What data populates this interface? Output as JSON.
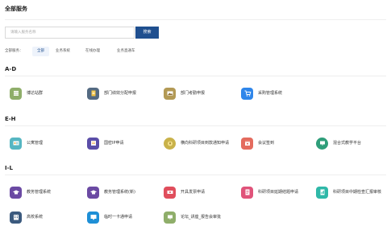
{
  "page": {
    "title": "全部服务"
  },
  "search": {
    "placeholder": "请输入服务名称",
    "button": "搜索"
  },
  "filter": {
    "label": "全部服务：",
    "chips": [
      "全部",
      "业务系统",
      "在线办理",
      "业务直通车"
    ]
  },
  "sections": [
    {
      "heading": "A-D",
      "items": [
        {
          "label": "博达站群",
          "icon": "database-icon",
          "color": "#8fae6a"
        },
        {
          "label": "部门绩效分配申报",
          "icon": "clipboard-icon",
          "color": "#546a82"
        },
        {
          "label": "部门考勤申报",
          "icon": "photo-icon",
          "color": "#b39a55"
        },
        {
          "label": "采购管理系统",
          "icon": "cart-icon",
          "color": "#2f86ea"
        }
      ]
    },
    {
      "heading": "E-H",
      "items": [
        {
          "label": "公寓管理",
          "icon": "id-card-icon",
          "color": "#56b6c2"
        },
        {
          "label": "国密IP申请",
          "icon": "document-icon",
          "color": "#5b4ea8"
        },
        {
          "label": "横向科研项目到款通知申请",
          "icon": "money-bag-icon",
          "color": "#c9b24a"
        },
        {
          "label": "会议签到",
          "icon": "calendar-icon",
          "color": "#e46b5e"
        },
        {
          "label": "混合式教学平台",
          "icon": "presentation-icon",
          "color": "#2f9e7a"
        }
      ]
    },
    {
      "heading": "I-L",
      "items": [
        {
          "label": "教务管理系统",
          "icon": "graduation-cap-icon",
          "color": "#6b4aa3"
        },
        {
          "label": "教务管理系统(新)",
          "icon": "graduation-cap-icon",
          "color": "#6b4aa3"
        },
        {
          "label": "开具发票申请",
          "icon": "ticket-icon",
          "color": "#e04e5c"
        },
        {
          "label": "科研项目延期结题申请",
          "icon": "form-icon",
          "color": "#e0537a"
        },
        {
          "label": "科研项目中期检查汇报审核",
          "icon": "report-icon",
          "color": "#2fb8a8"
        },
        {
          "label": "高校系统",
          "icon": "building-icon",
          "color": "#3b5a7e"
        },
        {
          "label": "临时一卡通申请",
          "icon": "monitor-icon",
          "color": "#1e8fd6"
        },
        {
          "label": "论坛_讲座_报告会审批",
          "icon": "presentation-icon",
          "color": "#8fae6a"
        }
      ]
    }
  ]
}
